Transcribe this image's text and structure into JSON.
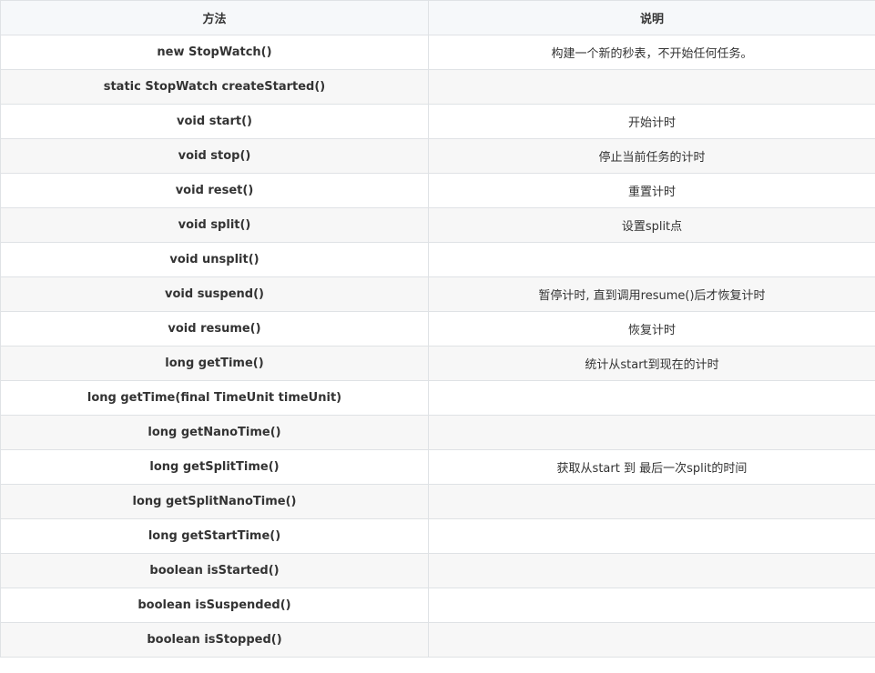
{
  "table": {
    "headers": [
      "方法",
      "说明"
    ],
    "rows": [
      {
        "method": "new StopWatch()",
        "desc": "构建一个新的秒表，不开始任何任务。"
      },
      {
        "method": "static StopWatch createStarted()",
        "desc": ""
      },
      {
        "method": "void start()",
        "desc": "开始计时"
      },
      {
        "method": "void stop()",
        "desc": "停止当前任务的计时"
      },
      {
        "method": "void reset()",
        "desc": "重置计时"
      },
      {
        "method": "void split()",
        "desc": "设置split点"
      },
      {
        "method": "void unsplit()",
        "desc": ""
      },
      {
        "method": "void suspend()",
        "desc": "暂停计时, 直到调用resume()后才恢复计时"
      },
      {
        "method": "void resume()",
        "desc": "恢复计时"
      },
      {
        "method": "long getTime()",
        "desc": "统计从start到现在的计时"
      },
      {
        "method": "long getTime(final TimeUnit timeUnit)",
        "desc": ""
      },
      {
        "method": "long getNanoTime()",
        "desc": ""
      },
      {
        "method": "long getSplitTime()",
        "desc": "获取从start 到 最后一次split的时间"
      },
      {
        "method": "long getSplitNanoTime()",
        "desc": ""
      },
      {
        "method": "long getStartTime()",
        "desc": ""
      },
      {
        "method": "boolean isStarted()",
        "desc": ""
      },
      {
        "method": "boolean isSuspended()",
        "desc": ""
      },
      {
        "method": "boolean isStopped()",
        "desc": ""
      }
    ]
  }
}
